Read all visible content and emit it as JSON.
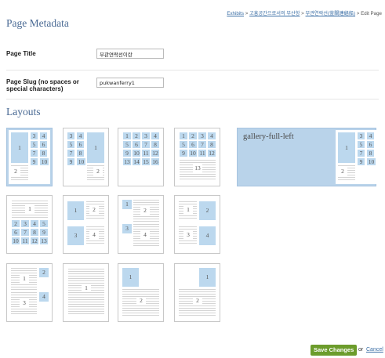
{
  "breadcrumb": {
    "exhibits": "Exhibits",
    "sep": ">",
    "exhibit": "고흥공간으로서의 부산항",
    "page": "부관연락선(釜關連絡船)",
    "current": "Edit Page"
  },
  "metadata": {
    "heading": "Page Metadata",
    "title_label": "Page Title",
    "title_value": "부관연락선이란",
    "slug_label_line1": "Page Slug (no spaces or",
    "slug_label_line2": "special characters)",
    "slug_value": "pukwanferry1"
  },
  "layouts": {
    "heading": "Layouts",
    "selected": "gallery-full-left",
    "wide_label": "gallery-full-left",
    "colors": {
      "selected_bg": "#b9d3ea",
      "block": "#bcd8ee"
    }
  },
  "labels": {
    "n1": "1",
    "n2": "2",
    "n3": "3",
    "n4": "4",
    "n5": "5",
    "n6": "6",
    "n7": "7",
    "n8": "8",
    "n9": "9",
    "n10": "10",
    "n11": "11",
    "n12": "12",
    "n13": "13",
    "n14": "14",
    "n15": "15",
    "n16": "16"
  },
  "footer": {
    "save_label": "Save Changes",
    "or_text": "or",
    "cancel_label": "Cancel"
  },
  "colors": {
    "heading": "#4a6a94",
    "link": "#3a6ea5",
    "save_bg": "#6c9c2c"
  }
}
